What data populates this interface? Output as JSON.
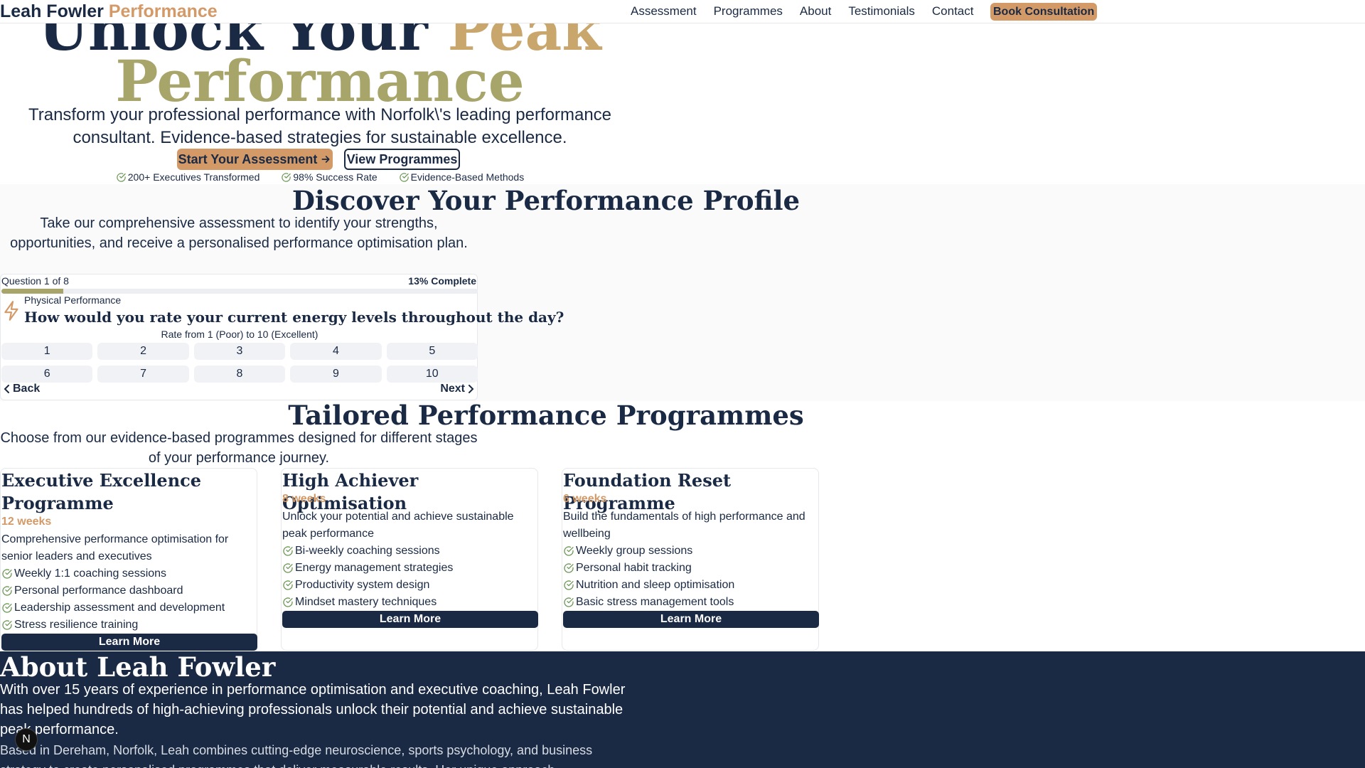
{
  "nav": {
    "logo_name": "Leah Fowler",
    "logo_accent": "Performance",
    "links": [
      "Assessment",
      "Programmes",
      "About",
      "Testimonials",
      "Contact"
    ],
    "cta": "Book Consultation"
  },
  "hero": {
    "title_part1": "Unlock Your",
    "title_part2": "Peak",
    "title_line2": "Performance",
    "subtitle": "Transform your professional performance with Norfolk\\'s leading performance consultant. Evidence-based strategies for sustainable excellence.",
    "primary_button": "Start Your Assessment",
    "secondary_button": "View Programmes",
    "stats": [
      "200+ Executives Transformed",
      "98% Success Rate",
      "Evidence-Based Methods"
    ]
  },
  "assessment": {
    "title": "Discover Your Performance Profile",
    "subtitle": "Take our comprehensive assessment to identify your strengths, opportunities, and receive a personalised performance optimisation plan.",
    "question_count": "Question 1 of 8",
    "percent_label": "13% Complete",
    "progress": 0.13,
    "category": "Physical Performance",
    "question": "How would you rate your current energy levels throughout the day?",
    "hint": "Rate from 1 (Poor) to 10 (Excellent)",
    "options": [
      "1",
      "2",
      "3",
      "4",
      "5",
      "6",
      "7",
      "8",
      "9",
      "10"
    ],
    "back": "Back",
    "next": "Next"
  },
  "programmes": {
    "title": "Tailored Performance Programmes",
    "subtitle": "Choose from our evidence-based programmes designed for different stages of your performance journey.",
    "cards": [
      {
        "title": "Executive Excellence Programme",
        "duration": "12 weeks",
        "description": "Comprehensive performance optimisation for senior leaders and executives",
        "features": [
          "Weekly 1:1 coaching sessions",
          "Personal performance dashboard",
          "Leadership assessment and development",
          "Stress resilience training"
        ],
        "button": "Learn More"
      },
      {
        "title": "High Achiever Optimisation",
        "duration": "8 weeks",
        "description": "Unlock your potential and achieve sustainable peak performance",
        "features": [
          "Bi-weekly coaching sessions",
          "Energy management strategies",
          "Productivity system design",
          "Mindset mastery techniques"
        ],
        "button": "Learn More"
      },
      {
        "title": "Foundation Reset Programme",
        "duration": "6 weeks",
        "description": "Build the fundamentals of high performance and wellbeing",
        "features": [
          "Weekly group sessions",
          "Personal habit tracking",
          "Nutrition and sleep optimisation",
          "Basic stress management tools"
        ],
        "button": "Learn More"
      }
    ]
  },
  "about": {
    "title": "About Leah Fowler",
    "p1": "With over 15 years of experience in performance optimisation and executive coaching, Leah Fowler has helped hundreds of high-achieving professionals unlock their potential and achieve sustainable peak performance.",
    "p2": "Based in Dereham, Norfolk, Leah combines cutting-edge neuroscience, sports psychology, and business strategy to create personalised programmes that deliver measurable results. Her unique approach"
  },
  "floating_badge": "N",
  "colors": {
    "navy": "#1a2a44",
    "accent": "#d39a68",
    "olive": "#a8a56a",
    "check": "#6f9a5a"
  }
}
